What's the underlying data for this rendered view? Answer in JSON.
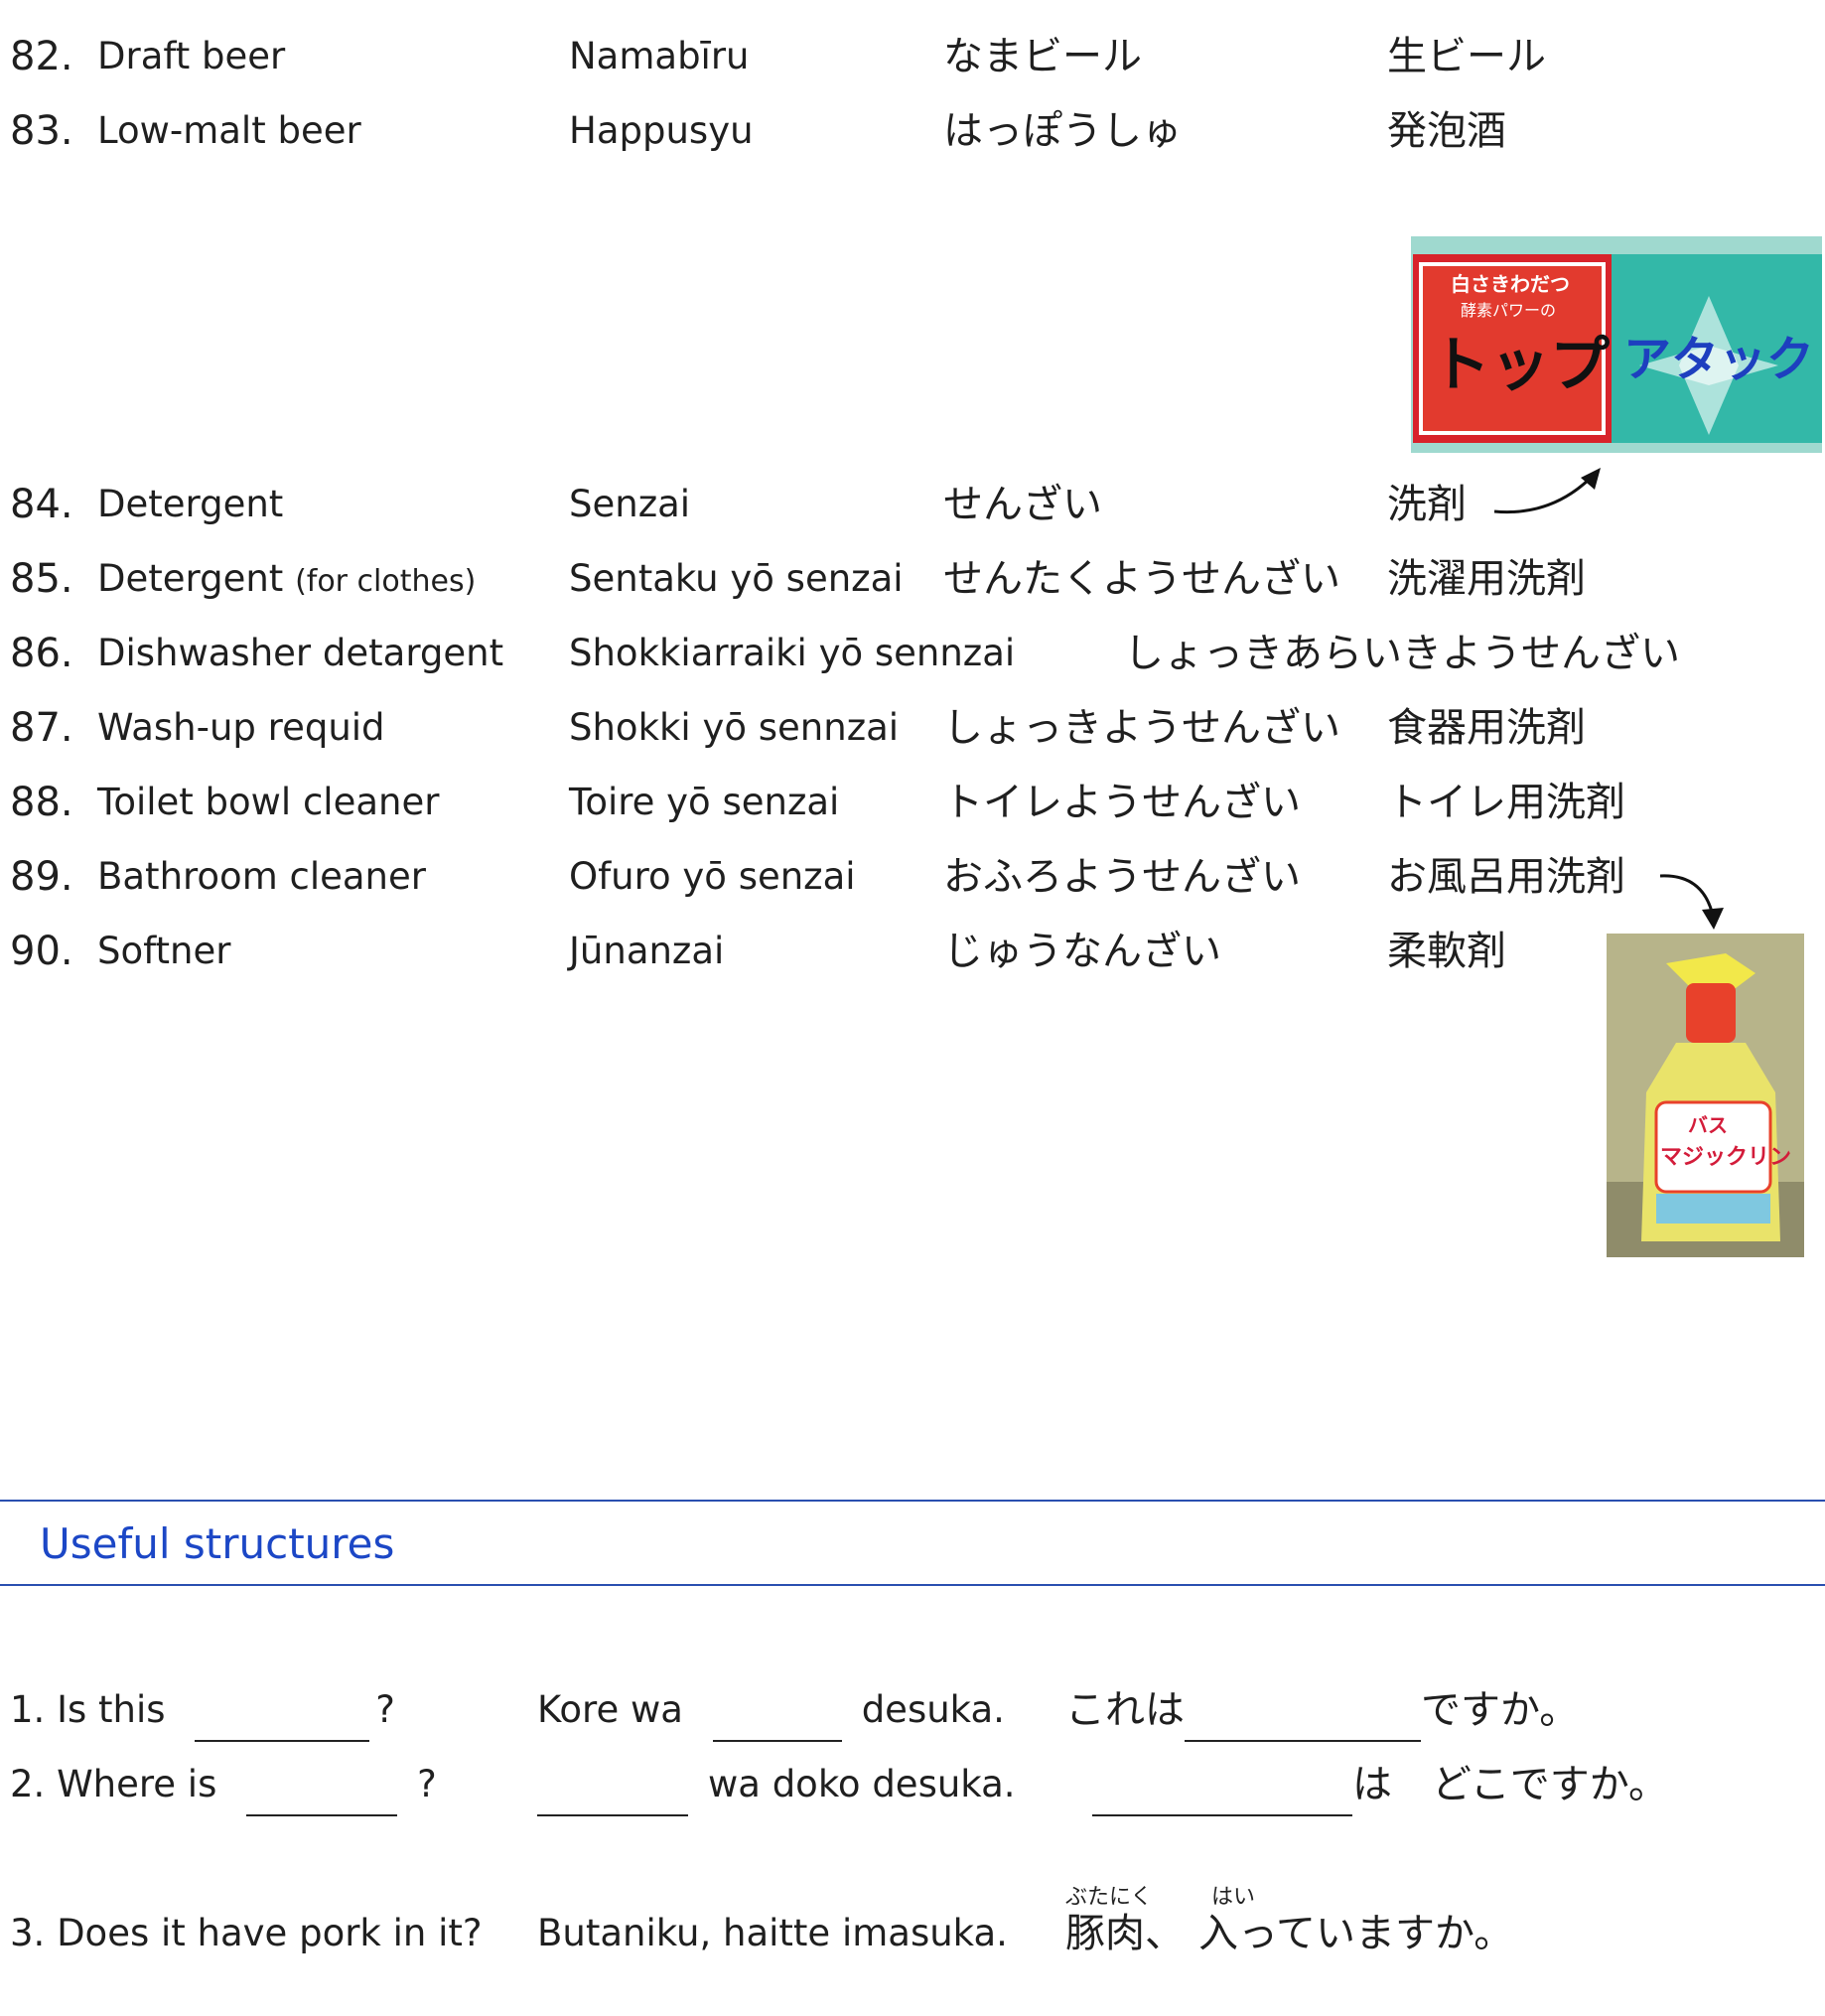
{
  "vocab": [
    {
      "num": "82.",
      "en": "Draft beer",
      "note": "",
      "romaji": "Namabīru",
      "kana": "なまビール",
      "kanji": "生ビール"
    },
    {
      "num": "83.",
      "en": "Low-malt beer",
      "note": "",
      "romaji": "Happusyu",
      "kana": "はっぽうしゅ",
      "kanji": "発泡酒"
    },
    {
      "num": "84.",
      "en": "Detergent",
      "note": "",
      "romaji": "Senzai",
      "kana": "せんざい",
      "kanji": "洗剤"
    },
    {
      "num": "85.",
      "en": "Detergent",
      "note": "(for clothes)",
      "romaji": "Sentaku yō senzai",
      "kana": "せんたくようせんざい",
      "kanji": "洗濯用洗剤"
    },
    {
      "num": "86.",
      "en": "Dishwasher detargent",
      "note": "",
      "romaji": "Shokkiarraiki yō sennzai",
      "kana": "しょっきあらいきようせんざい",
      "kanji": ""
    },
    {
      "num": "87.",
      "en": "Wash-up requid",
      "note": "",
      "romaji": "Shokki yō sennzai",
      "kana": "しょっきようせんざい",
      "kanji": "食器用洗剤"
    },
    {
      "num": "88.",
      "en": "Toilet bowl cleaner",
      "note": "",
      "romaji": "Toire yō senzai",
      "kana": "トイレようせんざい",
      "kanji": "トイレ用洗剤"
    },
    {
      "num": "89.",
      "en": "Bathroom cleaner",
      "note": "",
      "romaji": "Ofuro yō senzai",
      "kana": "おふろようせんざい",
      "kanji": "お風呂用洗剤"
    },
    {
      "num": "90.",
      "en": "Softner",
      "note": "",
      "romaji": "Jūnanzai",
      "kana": "じゅうなんざい",
      "kanji": "柔軟剤"
    }
  ],
  "images": {
    "detergent_boxes": {
      "text_a": "トップ",
      "text_b": "アタック",
      "small_a": "白さきわだつ",
      "small_b": "酵素パワーの"
    },
    "spray": {
      "text": "マジックリン",
      "small": "バス"
    }
  },
  "section": {
    "title": "Useful structures"
  },
  "structures": [
    {
      "en_a": "1. Is this",
      "en_b": "?",
      "ro_a": "Kore wa",
      "ro_b": "desuka.",
      "jp_a": "これは",
      "jp_b": "ですか。"
    },
    {
      "en_a": "2. Where is",
      "en_b": "?",
      "ro_a": "",
      "ro_b": "wa doko desuka.",
      "jp_a": "",
      "jp_b": "は　どこですか。"
    },
    {
      "en_a": "3. Does it have pork in it?",
      "ro_a": "Butaniku, haitte imasuka.",
      "jp_kanji1": "豚肉",
      "jp_mid": "、",
      "jp_kanji2": "入",
      "jp_end": "っていますか。",
      "furigana1": "ぶたにく",
      "furigana2": "はい"
    }
  ],
  "colors": {
    "accent": "#1c47c6",
    "rule": "#2a4fb0"
  }
}
